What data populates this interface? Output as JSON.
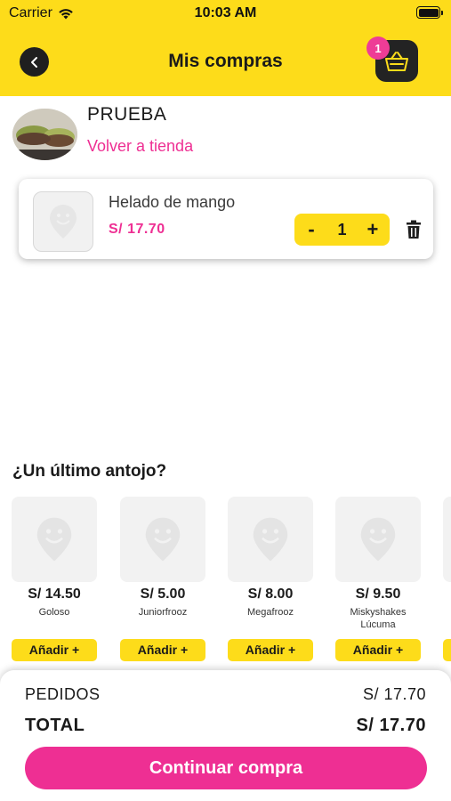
{
  "status_bar": {
    "carrier": "Carrier",
    "time": "10:03 AM"
  },
  "nav": {
    "title": "Mis compras",
    "cart_count": "1"
  },
  "store": {
    "name": "PRUEBA",
    "back_link": "Volver a tienda"
  },
  "cart_item": {
    "name": "Helado de mango",
    "price": "S/ 17.70",
    "quantity": "1",
    "decrement": "-",
    "increment": "+"
  },
  "suggestions": {
    "title": "¿Un último antojo?",
    "products": [
      {
        "price": "S/ 14.50",
        "name": "Goloso",
        "add_label": "Añadir +"
      },
      {
        "price": "S/ 5.00",
        "name": "Juniorfrooz",
        "add_label": "Añadir +"
      },
      {
        "price": "S/ 8.00",
        "name": "Megafrooz",
        "add_label": "Añadir +"
      },
      {
        "price": "S/ 9.50",
        "name": "Miskyshakes Lúcuma",
        "add_label": "Añadir +"
      }
    ]
  },
  "summary": {
    "orders_label": "PEDIDOS",
    "orders_value": "S/ 17.70",
    "total_label": "TOTAL",
    "total_value": "S/ 17.70",
    "continue_label": "Continuar compra"
  },
  "colors": {
    "brand_yellow": "#fddc1a",
    "brand_pink": "#ee2f93",
    "dark": "#232323"
  }
}
